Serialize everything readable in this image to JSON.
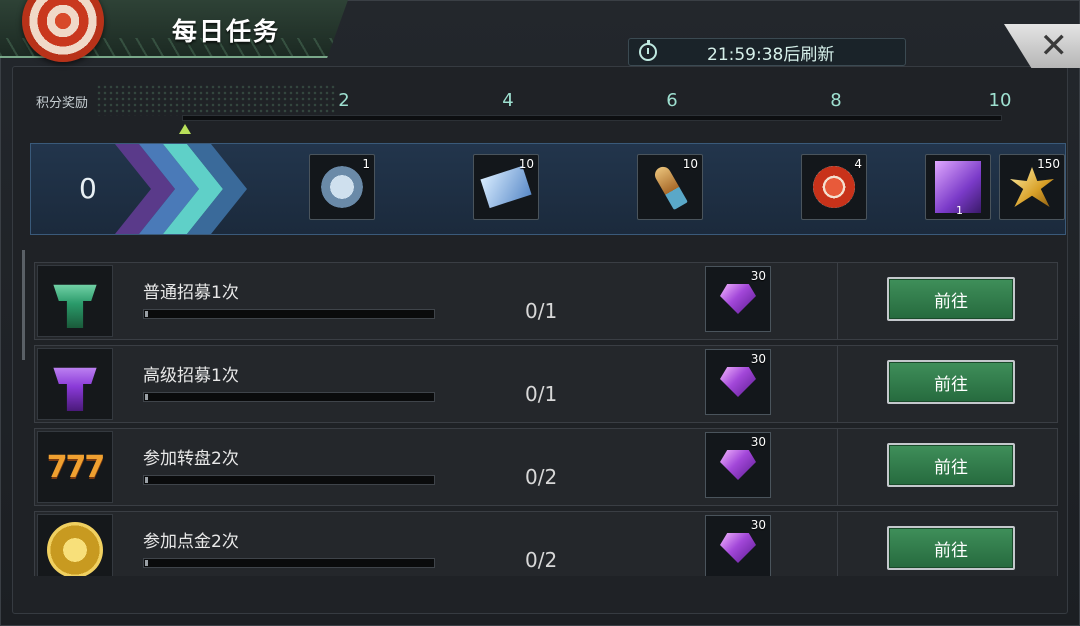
{
  "header": {
    "title": "每日任务",
    "timer_text": "21:59:38后刷新"
  },
  "score": {
    "label": "积分奖励",
    "current": "0",
    "ticks": [
      "2",
      "4",
      "6",
      "8",
      "10"
    ]
  },
  "rewards": [
    {
      "icon": "silver-coin-icon",
      "count": "1"
    },
    {
      "icon": "cinema-ticket-icon",
      "count": "10"
    },
    {
      "icon": "bullet-icon",
      "count": "10"
    },
    {
      "icon": "poker-chip-icon",
      "count": "4"
    },
    {
      "icon": "purple-character-card-icon",
      "count": "1"
    },
    {
      "icon": "gold-leaf-icon",
      "count": "150"
    }
  ],
  "tasks": [
    {
      "title": "普通招募1次",
      "progress": "0/1",
      "reward_count": "30",
      "button": "前往",
      "icon": "green-recruit-icon"
    },
    {
      "title": "高级招募1次",
      "progress": "0/1",
      "reward_count": "30",
      "button": "前往",
      "icon": "purple-recruit-icon"
    },
    {
      "title": "参加转盘2次",
      "progress": "0/2",
      "reward_count": "30",
      "button": "前往",
      "icon": "slot-777-icon"
    },
    {
      "title": "参加点金2次",
      "progress": "0/2",
      "reward_count": "30",
      "button": "前往",
      "icon": "gold-diamond-coin-icon"
    }
  ],
  "colors": {
    "accent_green": "#3f8f5a",
    "tick_color": "#9ee0d0",
    "gem_purple": "#a247d9"
  }
}
